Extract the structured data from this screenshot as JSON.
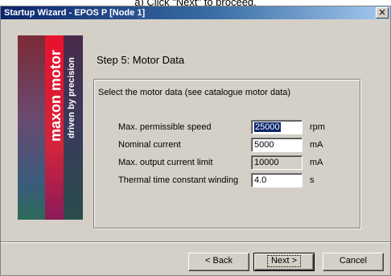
{
  "caption": "a) Click \"Next\" to proceed.",
  "window": {
    "title": "Startup Wizard - EPOS P [Node 1]",
    "close_glyph": "×"
  },
  "banner": {
    "brand": "maxon motor",
    "tagline": "driven by precision"
  },
  "step_title": "Step 5: Motor Data",
  "description": "Select the motor data (see catalogue motor data)",
  "fields": [
    {
      "label": "Max. permissible speed",
      "value": "25000",
      "unit": "rpm",
      "selected": true,
      "enabled": true
    },
    {
      "label": "Nominal current",
      "value": "5000",
      "unit": "mA",
      "enabled": true
    },
    {
      "label": "Max. output current limit",
      "value": "10000",
      "unit": "mA",
      "enabled": false
    },
    {
      "label": "Thermal time constant winding",
      "value": "4.0",
      "unit": "s",
      "enabled": true
    }
  ],
  "buttons": {
    "back": "< Back",
    "next": "Next >",
    "cancel": "Cancel"
  },
  "colors": {
    "titlebar_start": "#0a246a",
    "titlebar_end": "#a6caf0",
    "dialog_face": "#d4d0c8",
    "brand_red": "#e8112d"
  }
}
